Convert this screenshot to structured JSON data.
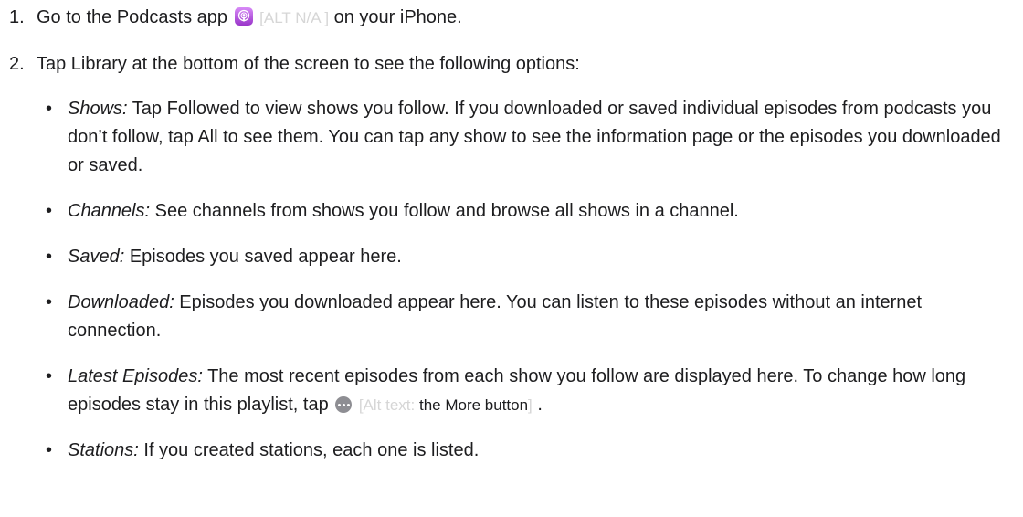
{
  "steps": [
    {
      "number": "1.",
      "before": "Go to the Podcasts app ",
      "icon_name": "podcasts-app-icon",
      "alt_text": "[ALT N/A ]",
      "after": " on your iPhone."
    },
    {
      "number": "2.",
      "text": "Tap Library at the bottom of the screen to see the following options:",
      "bullets": [
        {
          "marker": "•",
          "term": "Shows:",
          "text": " Tap Followed to view shows you follow. If you downloaded or saved individual episodes from podcasts you don’t follow, tap All to see them. You can tap any show to see the information page or the episodes you downloaded or saved."
        },
        {
          "marker": "•",
          "term": "Channels:",
          "text": " See channels from shows you follow and browse all shows in a channel."
        },
        {
          "marker": "•",
          "term": "Saved:",
          "text": " Episodes you saved appear here."
        },
        {
          "marker": "•",
          "term": "Downloaded:",
          "text": " Episodes you downloaded appear here. You can listen to these episodes without an internet connection."
        },
        {
          "marker": "•",
          "term": "Latest Episodes:",
          "text": " The most recent episodes from each show you follow are displayed here. To change how long episodes stay in this playlist, tap ",
          "icon_name": "more-button-icon",
          "alt_prefix": "[Alt text: ",
          "alt_label": "the More button",
          "alt_suffix": "]",
          "after": " ."
        },
        {
          "marker": "•",
          "term": "Stations:",
          "text": " If you created stations, each one is listed."
        }
      ]
    }
  ]
}
